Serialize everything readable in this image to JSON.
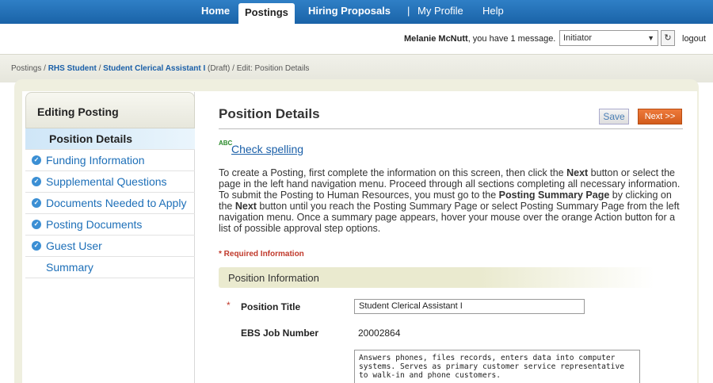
{
  "nav": {
    "home": "Home",
    "postings": "Postings",
    "hiring_proposals": "Hiring Proposals",
    "separator": "|",
    "my_profile": "My Profile",
    "help": "Help"
  },
  "userbar": {
    "user_name": "Melanie McNutt",
    "message": ", you have 1 message.",
    "role": "Initiator",
    "logout": "logout"
  },
  "breadcrumb": {
    "postings": "Postings",
    "sep1": " / ",
    "rhs_student": "RHS Student",
    "sep2": " / ",
    "posting": "Student Clerical Assistant I",
    "draft": " (Draft)",
    "sep3": " / ",
    "current": "Edit: Position Details"
  },
  "sidebar": {
    "header": "Editing Posting",
    "items": [
      {
        "label": "Position Details",
        "active": true
      },
      {
        "label": "Funding Information",
        "checked": true
      },
      {
        "label": "Supplemental Questions",
        "checked": true
      },
      {
        "label": "Documents Needed to Apply",
        "checked": true
      },
      {
        "label": "Posting Documents",
        "checked": true
      },
      {
        "label": "Guest User",
        "checked": true
      },
      {
        "label": "Summary"
      }
    ]
  },
  "content": {
    "title": "Position Details",
    "save": "Save",
    "next": "Next >>",
    "spell_icon": "ABC",
    "spell": "Check spelling",
    "instructions": {
      "p1": "To create a Posting, first complete the information on this screen, then click the ",
      "next1": "Next",
      "p2": " button or select the page in the left hand navigation menu. Proceed through all sections completing all necessary information. To submit the Posting to Human Resources, you must go to the ",
      "summary_page": "Posting Summary Page",
      "p3": " by clicking on the ",
      "next2": "Next",
      "p4": " button until you reach the Posting Summary Page or select Posting Summary Page from the left navigation menu. Once a summary page appears, hover your mouse over the orange Action button for a list of possible approval step options."
    },
    "required": "* Required Information",
    "section": "Position Information",
    "fields": {
      "star": "*",
      "position_title_label": "Position Title",
      "position_title_value": "Student Clerical Assistant I",
      "ebs_label": "EBS Job Number",
      "ebs_value": "20002864",
      "description": "Answers phones, files records, enters data into computer systems. Serves as primary customer service representative to walk-in and phone customers."
    }
  }
}
